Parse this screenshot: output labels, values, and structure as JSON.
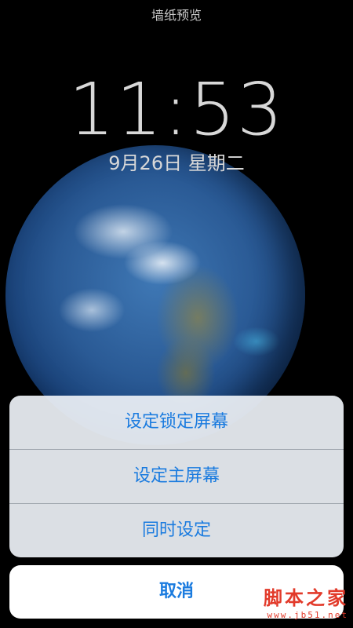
{
  "header": {
    "title": "墙纸预览"
  },
  "lock_screen": {
    "time": "11:53",
    "date": "9月26日 星期二"
  },
  "action_sheet": {
    "options": [
      {
        "label": "设定锁定屏幕"
      },
      {
        "label": "设定主屏幕"
      },
      {
        "label": "同时设定"
      }
    ],
    "cancel_label": "取消"
  },
  "watermark": {
    "text": "脚本之家",
    "url": "www.jb51.net"
  },
  "colors": {
    "accent": "#1a7bdf",
    "watermark": "#e23a2a"
  }
}
